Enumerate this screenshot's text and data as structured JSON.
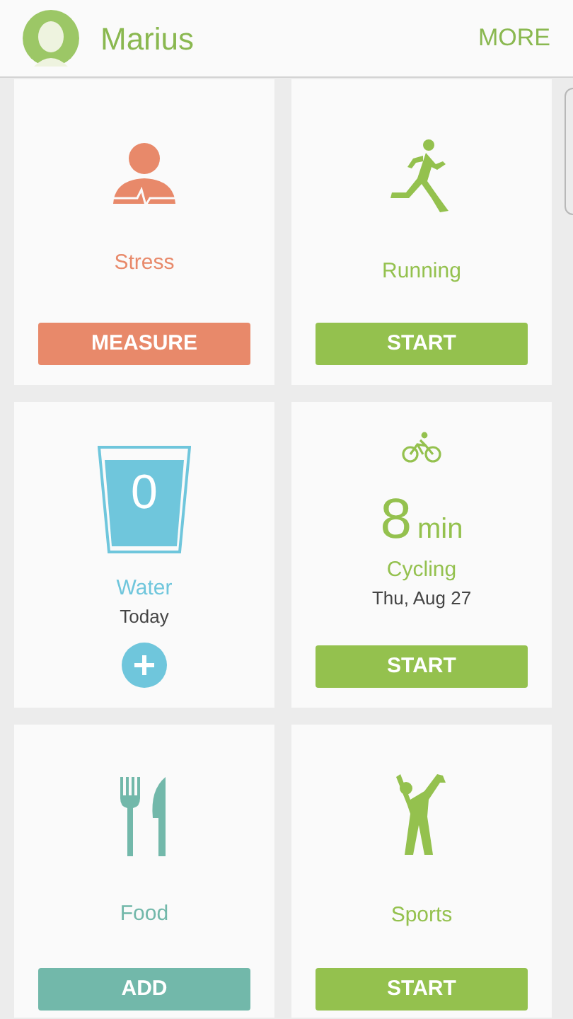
{
  "header": {
    "name": "Marius",
    "more": "MORE"
  },
  "cards": [
    {
      "kind": "stress",
      "color": "#e8896a",
      "label": "Stress",
      "button": "MEASURE"
    },
    {
      "kind": "running",
      "color": "#94c14e",
      "label": "Running",
      "button": "START"
    },
    {
      "kind": "water",
      "color": "#6fc6dc",
      "count": "0",
      "label": "Water",
      "sublabel": "Today"
    },
    {
      "kind": "cycling",
      "color": "#94c14e",
      "value": "8",
      "unit": "min",
      "label": "Cycling",
      "sublabel": "Thu, Aug 27",
      "button": "START"
    },
    {
      "kind": "food",
      "color": "#72b8aa",
      "label": "Food",
      "button": "ADD"
    },
    {
      "kind": "sports",
      "color": "#94c14e",
      "label": "Sports",
      "button": "START"
    }
  ]
}
